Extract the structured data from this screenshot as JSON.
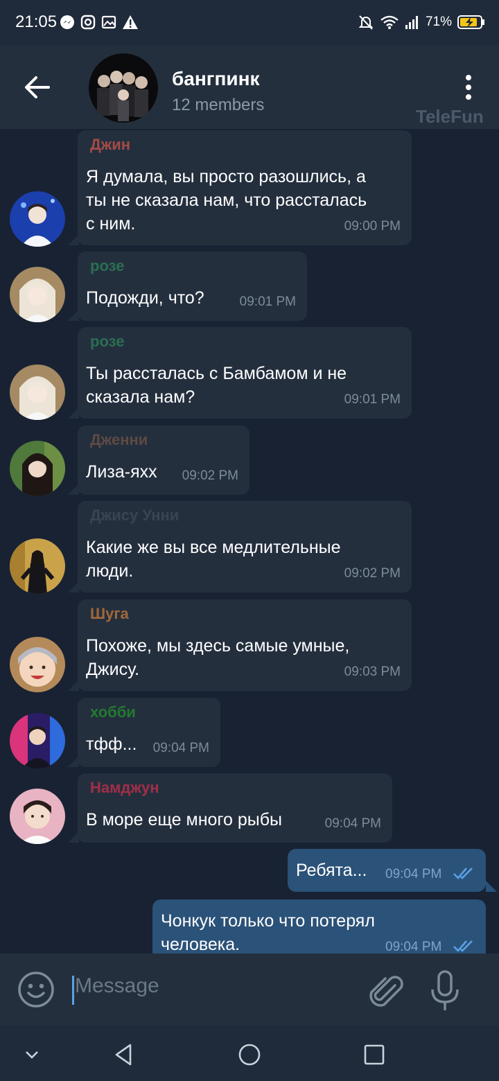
{
  "status_bar": {
    "time": "21:05",
    "battery": "71%"
  },
  "header": {
    "title": "бангпинк",
    "subtitle": "12 members",
    "watermark": "TeleFun"
  },
  "messages": [
    {
      "sender": "Джин",
      "sender_color": "#a64b47",
      "text": "Я думала, вы просто разошлись, а\nты не сказала нам, что рассталась\nс ним.",
      "time": "09:00 PM",
      "avatar": "Jin"
    },
    {
      "sender": "розе",
      "sender_color": "#2a6f52",
      "text": "Подожди, что?",
      "time": "09:01 PM",
      "avatar": "Rose"
    },
    {
      "sender": "розе",
      "sender_color": "#2a6f52",
      "text": "Ты рассталась с Бамбамом и не\nсказала нам?",
      "time": "09:01 PM",
      "avatar": "Rose"
    },
    {
      "sender": "Дженни",
      "sender_color": "#5e4a43",
      "text": "Лиза-яхх",
      "time": "09:02 PM",
      "avatar": "Jennie"
    },
    {
      "sender": "Джису Унни",
      "sender_color": "#3a4452",
      "text": "Какие же вы все медлительные\nлюди.",
      "time": "09:02 PM",
      "avatar": "Jisoo"
    },
    {
      "sender": "Шуга",
      "sender_color": "#a2683a",
      "text": "Похоже, мы здесь самые умные,\nДжису.",
      "time": "09:03 PM",
      "avatar": "Suga"
    },
    {
      "sender": "хобби",
      "sender_color": "#237a2f",
      "text": "тфф...",
      "time": "09:04 PM",
      "avatar": "Hobi"
    },
    {
      "sender": "Намджун",
      "sender_color": "#a22e47",
      "text": "В море еще много рыбы",
      "time": "09:04 PM",
      "avatar": "Namjoon"
    },
    {
      "text": "Ребята...",
      "time": "09:04 PM",
      "outgoing": true
    },
    {
      "text": "Чонкук только что потерял\nчеловека.",
      "time": "09:04 PM",
      "outgoing": true
    }
  ],
  "input": {
    "placeholder": "Message"
  },
  "icons": {
    "back": "arrow-left-icon",
    "menu": "more-vertical-icon",
    "emoji": "smile-icon",
    "attach": "paperclip-icon",
    "mic": "microphone-icon",
    "read": "double-check-icon"
  },
  "colors": {
    "accent": "#5aa2e8",
    "outgoing_bubble": "#2b5278",
    "incoming_bubble": "#242f3e",
    "background": "#182233"
  }
}
